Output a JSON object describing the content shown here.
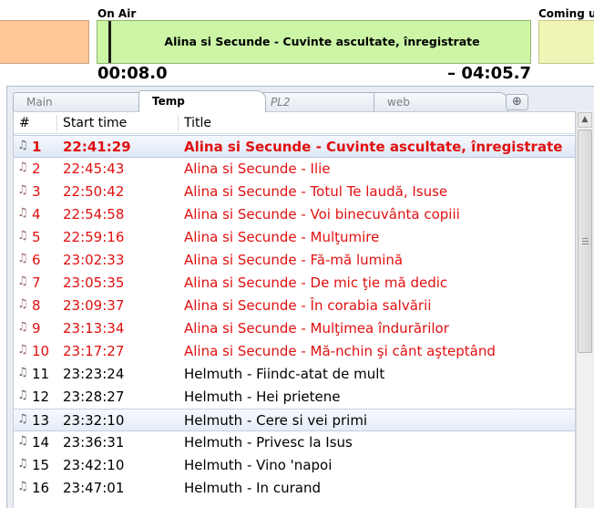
{
  "deck": {
    "on_air_label": "On Air",
    "coming_label": "Coming up",
    "on_air_title": "Alina si Secunde - Cuvinte ascultate, înregistrate",
    "elapsed": "00:08.0",
    "remaining": "– 04:05.7"
  },
  "tabs": [
    {
      "label": "Main",
      "active": false
    },
    {
      "label": "Temp",
      "active": true
    },
    {
      "label": "PL2",
      "active": false
    },
    {
      "label": "web",
      "active": false
    }
  ],
  "tab_add_icon": "add-tab-icon",
  "columns": {
    "num": "#",
    "start": "Start time",
    "title": "Title"
  },
  "rows": [
    {
      "num": "1",
      "time": "22:41:29",
      "title": "Alina si Secunde - Cuvinte ascultate, înregistrate",
      "state": "current"
    },
    {
      "num": "2",
      "time": "22:45:43",
      "title": "Alina si Secunde - Ilie",
      "state": "played"
    },
    {
      "num": "3",
      "time": "22:50:42",
      "title": "Alina si Secunde - Totul Te laudă, Isuse",
      "state": "played"
    },
    {
      "num": "4",
      "time": "22:54:58",
      "title": "Alina si Secunde - Voi binecuvânta copiii",
      "state": "played"
    },
    {
      "num": "5",
      "time": "22:59:16",
      "title": "Alina si Secunde - Mulţumire",
      "state": "played"
    },
    {
      "num": "6",
      "time": "23:02:33",
      "title": "Alina si Secunde - Fă-mă lumină",
      "state": "played"
    },
    {
      "num": "7",
      "time": "23:05:35",
      "title": "Alina si Secunde - De mic ţie mă dedic",
      "state": "played"
    },
    {
      "num": "8",
      "time": "23:09:37",
      "title": "Alina si Secunde - În corabia salvării",
      "state": "played"
    },
    {
      "num": "9",
      "time": "23:13:34",
      "title": "Alina si Secunde - Mulţimea îndurărilor",
      "state": "played"
    },
    {
      "num": "10",
      "time": "23:17:27",
      "title": "Alina si Secunde - Mă-nchin şi cânt aşteptând",
      "state": "played"
    },
    {
      "num": "11",
      "time": "23:23:24",
      "title": "Helmuth - Fiindc-atat de mult",
      "state": "normal"
    },
    {
      "num": "12",
      "time": "23:28:27",
      "title": "Helmuth - Hei prietene",
      "state": "normal"
    },
    {
      "num": "13",
      "time": "23:32:10",
      "title": "Helmuth - Cere si vei primi",
      "state": "hilite"
    },
    {
      "num": "14",
      "time": "23:36:31",
      "title": "Helmuth - Privesc la Isus",
      "state": "normal"
    },
    {
      "num": "15",
      "time": "23:42:10",
      "title": "Helmuth - Vino 'napoi",
      "state": "normal"
    },
    {
      "num": "16",
      "time": "23:47:01",
      "title": "Helmuth - In curand",
      "state": "normal"
    }
  ],
  "colors": {
    "played": "#e01010",
    "on_air_bg": "#ccf5a6",
    "prev_bg": "#ffc896",
    "next_bg": "#f0f4b4"
  }
}
